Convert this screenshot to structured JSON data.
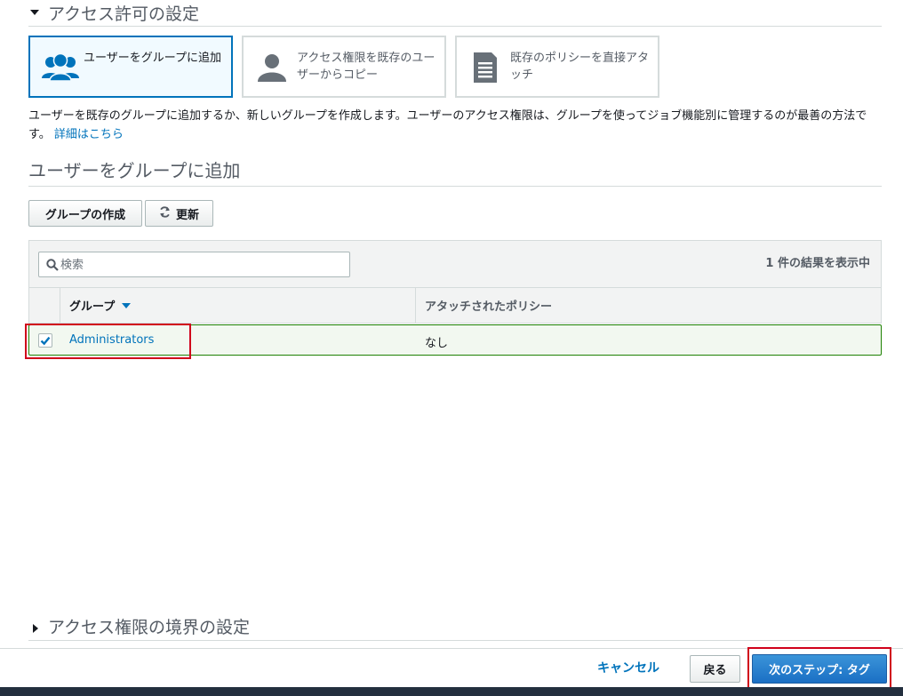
{
  "access_section": {
    "title": "アクセス許可の設定"
  },
  "options": [
    {
      "label": "ユーザーをグループに追加",
      "icon": "users-group-icon",
      "selected": true
    },
    {
      "label": "アクセス権限を既存のユーザーからコピー",
      "icon": "user-icon",
      "selected": false
    },
    {
      "label": "既存のポリシーを直接アタッチ",
      "icon": "document-icon",
      "selected": false
    }
  ],
  "description": {
    "text": "ユーザーを既存のグループに追加するか、新しいグループを作成します。ユーザーのアクセス権限は、グループを使ってジョブ機能別に管理するのが最善の方法です。",
    "link": "詳細はこちら"
  },
  "group_section": {
    "title": "ユーザーをグループに追加"
  },
  "toolbar": {
    "create_group_label": "グループの作成",
    "refresh_label": "更新",
    "refresh_icon": "refresh-icon"
  },
  "table": {
    "search_placeholder": "検索",
    "result_count": "1 件の結果を表示中",
    "columns": {
      "group": "グループ",
      "attached_policies": "アタッチされたポリシー"
    },
    "rows": [
      {
        "group": "Administrators",
        "attached_policies": "なし",
        "checked": true
      }
    ]
  },
  "boundary_section": {
    "title": "アクセス権限の境界の設定"
  },
  "footer": {
    "cancel_label": "キャンセル",
    "back_label": "戻る",
    "next_label": "次のステップ: タグ"
  },
  "colors": {
    "accent": "#0073bb",
    "primary_button": "#1a6fc4",
    "highlight": "#d0021b",
    "selected_row_border": "#1d8102"
  }
}
